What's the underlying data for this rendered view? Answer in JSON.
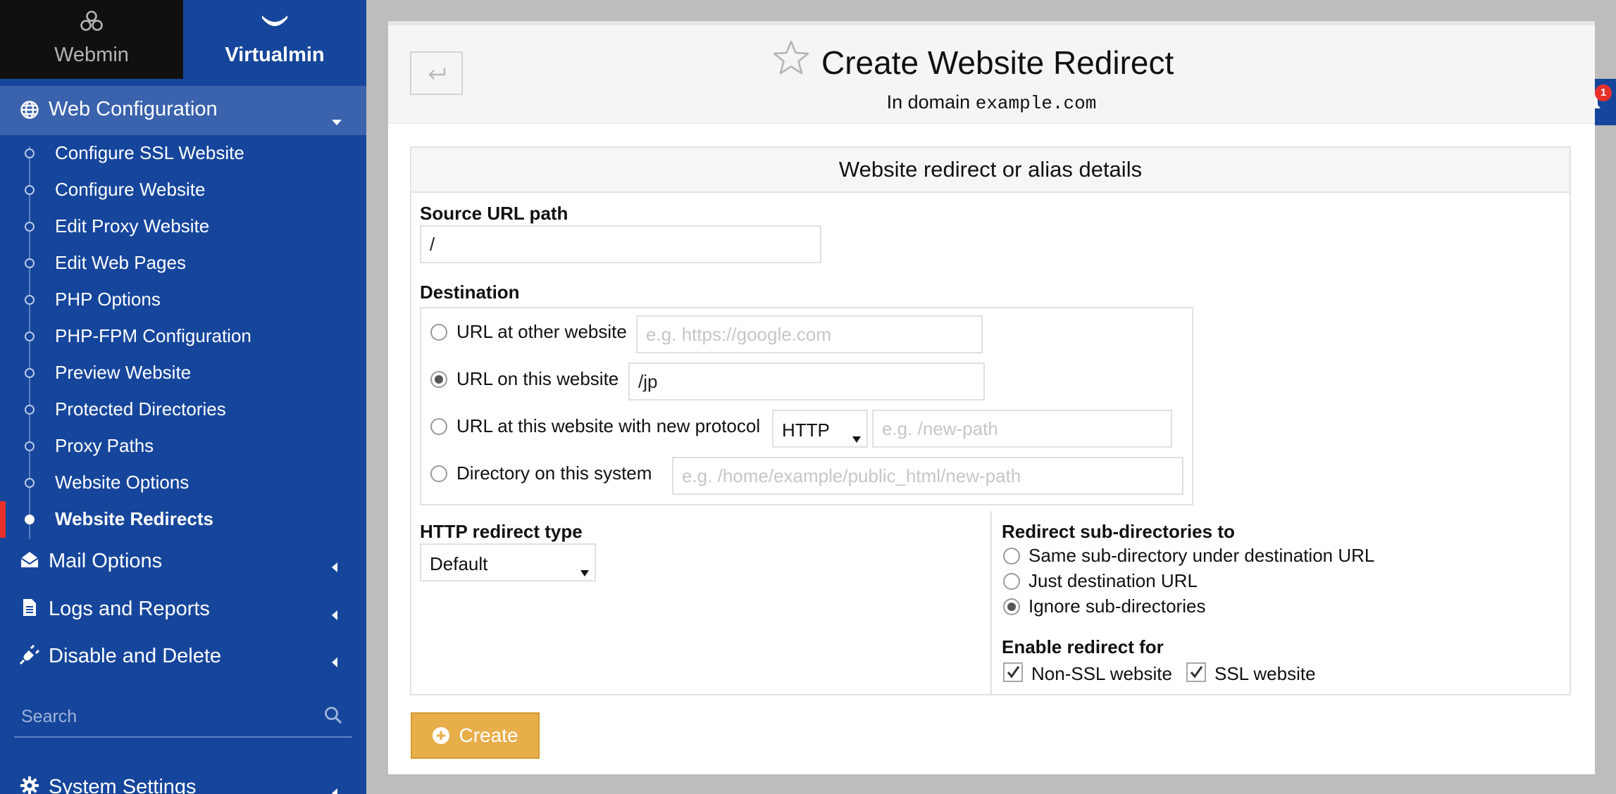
{
  "switcher": {
    "webmin_label": "Webmin",
    "virtualmin_label": "Virtualmin"
  },
  "sidebar": {
    "open_section": {
      "label": "Web Configuration",
      "icon": "globe-icon"
    },
    "sub_items": [
      {
        "label": "Configure SSL Website",
        "active": false
      },
      {
        "label": "Configure Website",
        "active": false
      },
      {
        "label": "Edit Proxy Website",
        "active": false
      },
      {
        "label": "Edit Web Pages",
        "active": false
      },
      {
        "label": "PHP Options",
        "active": false
      },
      {
        "label": "PHP-FPM Configuration",
        "active": false
      },
      {
        "label": "Preview Website",
        "active": false
      },
      {
        "label": "Protected Directories",
        "active": false
      },
      {
        "label": "Proxy Paths",
        "active": false
      },
      {
        "label": "Website Options",
        "active": false
      },
      {
        "label": "Website Redirects",
        "active": true
      }
    ],
    "sections": [
      {
        "label": "Mail Options",
        "icon": "envelope-open-icon"
      },
      {
        "label": "Logs and Reports",
        "icon": "document-icon"
      },
      {
        "label": "Disable and Delete",
        "icon": "plug-icon"
      }
    ],
    "search_placeholder": "Search",
    "system_settings": {
      "label": "System Settings",
      "icon": "gear-icon"
    }
  },
  "header": {
    "title": "Create Website Redirect",
    "subtitle_prefix": "In domain",
    "domain": "example.com"
  },
  "notifications": {
    "count": "1"
  },
  "form": {
    "panel_title": "Website redirect or alias details",
    "source_label": "Source URL path",
    "source_value": "/",
    "destination_label": "Destination",
    "destinations": [
      {
        "label": "URL at other website",
        "value": "",
        "placeholder": "e.g. https://google.com",
        "checked": false
      },
      {
        "label": "URL on this website",
        "value": "/jp",
        "placeholder": "",
        "checked": true
      },
      {
        "label": "URL at this website with new protocol",
        "protocol": "HTTP",
        "value": "",
        "placeholder": "e.g. /new-path",
        "checked": false
      },
      {
        "label": "Directory on this system",
        "value": "",
        "placeholder": "e.g. /home/example/public_html/new-path",
        "checked": false
      }
    ],
    "redirect_type_label": "HTTP redirect type",
    "redirect_type_value": "Default",
    "subdir_label": "Redirect sub-directories to",
    "subdir_options": [
      {
        "label": "Same sub-directory under destination URL",
        "checked": false
      },
      {
        "label": "Just destination URL",
        "checked": false
      },
      {
        "label": "Ignore sub-directories",
        "checked": true
      }
    ],
    "enable_label": "Enable redirect for",
    "enable_options": [
      {
        "label": "Non-SSL website",
        "checked": true
      },
      {
        "label": "SSL website",
        "checked": true
      }
    ],
    "create_label": "Create"
  },
  "colors": {
    "sidebar_bg": "#16469c",
    "accent_create": "#e8ae4a",
    "active_marker": "#e8312b"
  }
}
